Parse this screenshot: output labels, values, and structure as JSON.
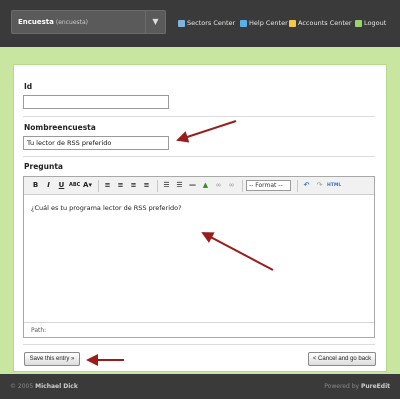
{
  "header": {
    "selector": {
      "name": "Encuesta",
      "sub": "(encuesta)"
    },
    "nav": [
      {
        "label": "Sectors Center",
        "icon": "sectors-icon"
      },
      {
        "label": "Help Center",
        "icon": "help-icon"
      },
      {
        "label": "Accounts Center",
        "icon": "accounts-icon"
      },
      {
        "label": "Logout",
        "icon": "logout-icon"
      }
    ]
  },
  "form": {
    "id_label": "Id",
    "id_value": "",
    "nombre_label": "Nombreencuesta",
    "nombre_value": "Tu lector de RSS preferido",
    "pregunta_label": "Pregunta",
    "pregunta_value": "¿Cuál es tu programa lector de RSS preferido?",
    "format_select": "-- Format --",
    "toolbar_html": "HTML",
    "path_label": "Path:"
  },
  "buttons": {
    "save": "Save this entry »",
    "cancel": "< Cancel and go back"
  },
  "footer": {
    "copyright_prefix": "© 2005",
    "author": "Michael Dick",
    "powered_prefix": "Powered by",
    "product": "PureEdit"
  },
  "colors": {
    "header_bg": "#3a3a3a",
    "frame_green": "#c9e6a0",
    "arrow_red": "#9b1c1c"
  }
}
